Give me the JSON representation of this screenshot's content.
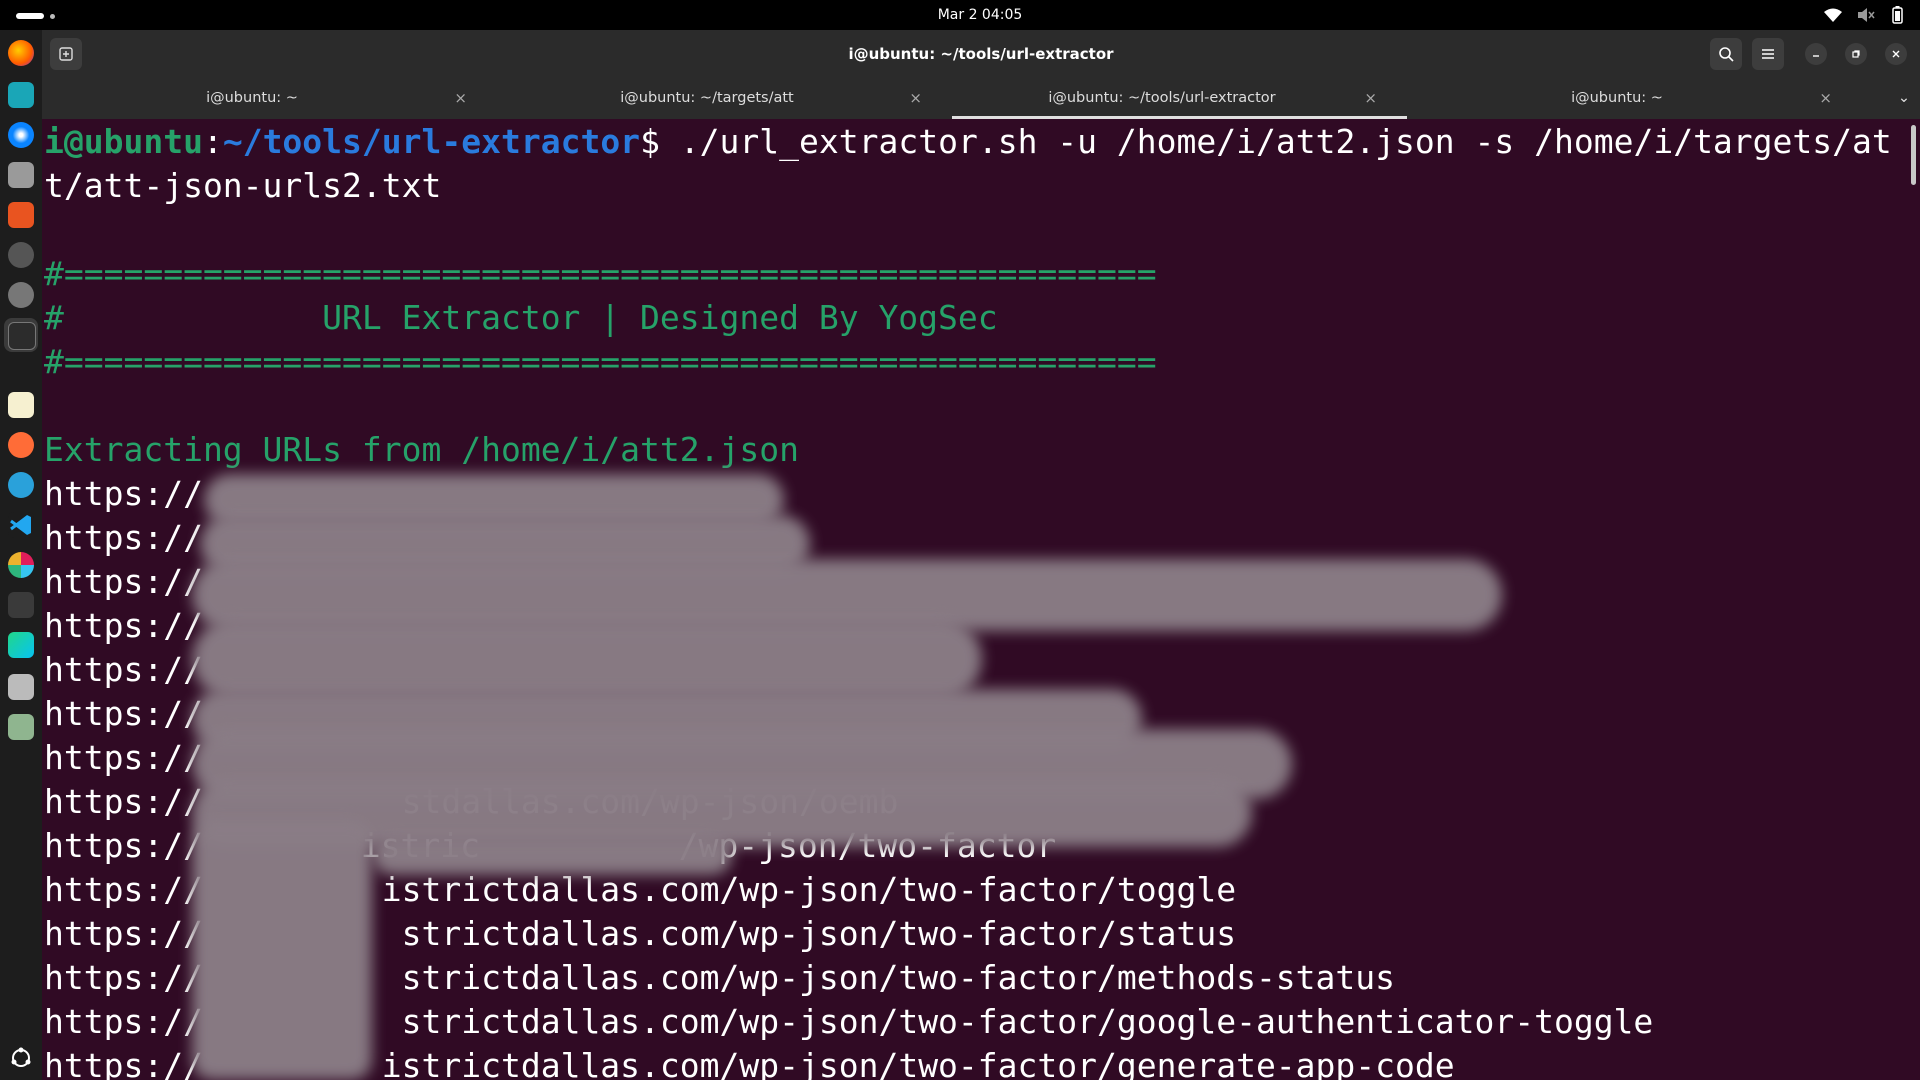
{
  "topbar": {
    "clock": "Mar 2  04:05"
  },
  "window": {
    "title": "i@ubuntu: ~/tools/url-extractor",
    "tabs": [
      {
        "label": "i@ubuntu: ~",
        "close": "×"
      },
      {
        "label": "i@ubuntu: ~/targets/att",
        "close": "×"
      },
      {
        "label": "i@ubuntu: ~/tools/url-extractor",
        "close": "×"
      },
      {
        "label": "i@ubuntu: ~",
        "close": "×"
      }
    ],
    "tab_menu": "⌄"
  },
  "dock_icons": [
    "firefox-icon",
    "thunderbolt-app-icon",
    "thunderbird-icon",
    "files-icon",
    "app-center-icon",
    "clock-icon",
    "settings-icon",
    "terminal-icon",
    "text-editor-icon",
    "postman-icon",
    "telegram-icon",
    "vscode-icon",
    "slack-icon",
    "system-monitor-icon",
    "pycharm-icon",
    "image-viewer-icon",
    "trash-icon",
    "show-apps-icon"
  ],
  "terminal": {
    "prompt_user": "i@ubuntu",
    "prompt_colon": ":",
    "prompt_path": "~/tools/url-extractor",
    "prompt_dollar": "$ ",
    "command_line1": "./url_extractor.sh -u /home/i/att2.json -s /home/i/targets/at",
    "command_line2": "t/att-json-urls2.txt",
    "banner_rule": "#=======================================================",
    "banner_title": "#             URL Extractor | Designed By YogSec",
    "extracting": "Extracting URLs from /home/i/att2.json",
    "url_lines": [
      "https://",
      "https://",
      "https://",
      "https://",
      "https://",
      "https://",
      "https://",
      "https://",
      "https://",
      "https://",
      "https://",
      "https://",
      "https://",
      "https://"
    ],
    "url_tails": [
      "",
      "",
      "",
      "",
      "",
      "",
      "",
      "          stdallas.com/wp-json/oemb",
      "",
      "         istrictdallas.com/wp-json/two-factor/toggle",
      "          strictdallas.com/wp-json/two-factor/status",
      "          strictdallas.com/wp-json/two-factor/methods-status",
      "          strictdallas.com/wp-json/two-factor/google-authenticator-toggle",
      "         istrictdallas.com/wp-json/two-factor/generate-app-code"
    ],
    "partial_visible": "         istric          /wp-json/two-factor"
  },
  "colors": {
    "terminal_bg": "#300a24",
    "prompt_green": "#26a269",
    "prompt_blue": "#12488b",
    "banner_green": "#26a269"
  }
}
